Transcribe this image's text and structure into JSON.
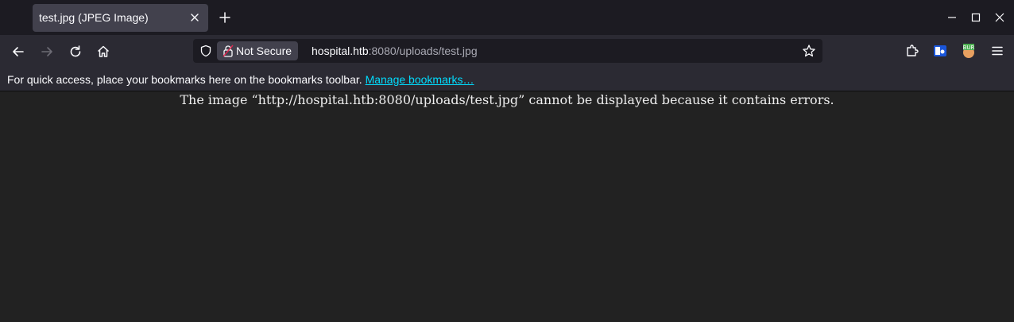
{
  "tab": {
    "title": "test.jpg (JPEG Image)",
    "close_icon": "close-icon"
  },
  "new_tab_icon": "plus-icon",
  "window_controls": [
    "minimize-icon",
    "maximize-icon",
    "close-icon"
  ],
  "nav": {
    "back_icon": "arrow-left-icon",
    "forward_icon": "arrow-right-icon",
    "reload_icon": "reload-icon",
    "home_icon": "home-icon"
  },
  "urlbar": {
    "security_label": "Not Secure",
    "url_host": "hospital.htb",
    "url_rest": ":8080/uploads/test.jpg",
    "bookmark_icon": "star-icon"
  },
  "toolbar_right": [
    "extensions-icon",
    "container-icon",
    "burp-icon",
    "menu-icon"
  ],
  "bookmarks_bar": {
    "message": "For quick access, place your bookmarks here on the bookmarks toolbar.",
    "link": "Manage bookmarks…"
  },
  "content": {
    "error_message": "The image “http://hospital.htb:8080/uploads/test.jpg” cannot be displayed because it contains errors."
  },
  "colors": {
    "tabbar_bg": "#1c1b22",
    "toolbar_bg": "#2b2a33",
    "active_tab_bg": "#42414d",
    "page_bg": "#222222",
    "link": "#00ddff"
  }
}
